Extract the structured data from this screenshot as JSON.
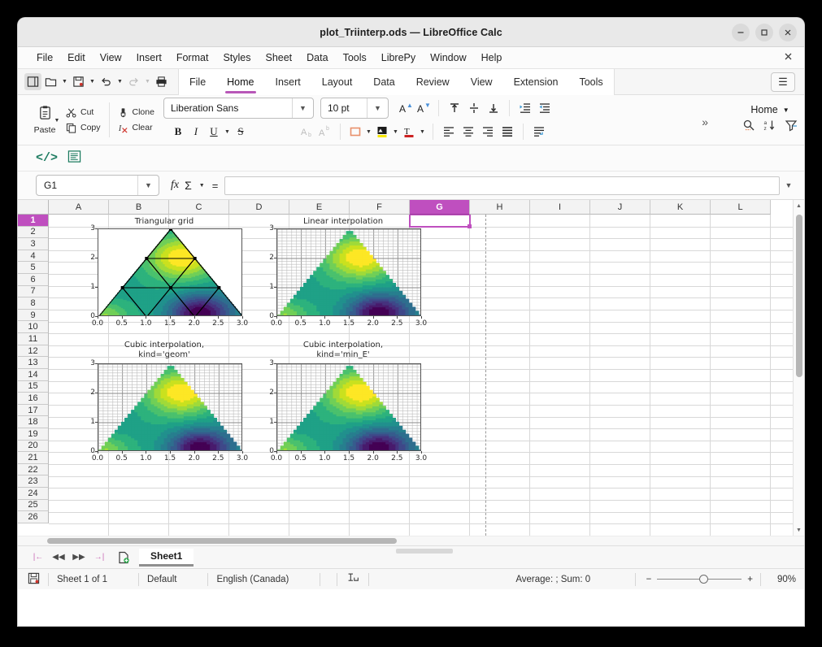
{
  "window": {
    "title": "plot_Triinterp.ods — LibreOffice Calc",
    "minimize": "−",
    "maximize": "□",
    "close": "✕"
  },
  "menubar": {
    "items": [
      "File",
      "Edit",
      "View",
      "Insert",
      "Format",
      "Styles",
      "Sheet",
      "Data",
      "Tools",
      "LibrePy",
      "Window",
      "Help"
    ],
    "close_document": "✕"
  },
  "notebookbar": {
    "tabs": [
      "File",
      "Home",
      "Insert",
      "Layout",
      "Data",
      "Review",
      "View",
      "Extension",
      "Tools"
    ],
    "selected_tab": "Home",
    "menu_button": "☰"
  },
  "ribbon": {
    "paste_label": "Paste",
    "cut_label": "Cut",
    "copy_label": "Copy",
    "clone_label": "Clone",
    "clear_label": "Clear",
    "font_name": "Liberation Sans",
    "font_size": "10 pt",
    "bold": "B",
    "italic": "I",
    "underline": "U",
    "strikethrough": "S",
    "grow_font": "A",
    "shrink_font": "A",
    "overflow": "»",
    "context_label": "Home",
    "accent_color": "#b857b8"
  },
  "formula": {
    "name_box": "G1",
    "fx_label": "fx",
    "sum_label": "Σ",
    "equals_label": "=",
    "input_value": "",
    "input_placeholder": ""
  },
  "grid": {
    "columns": [
      "A",
      "B",
      "C",
      "D",
      "E",
      "F",
      "G",
      "H",
      "I",
      "J",
      "K",
      "L"
    ],
    "selected_column": "G",
    "rows": [
      1,
      2,
      3,
      4,
      5,
      6,
      7,
      8,
      9,
      10,
      11,
      12,
      13,
      14,
      15,
      16,
      17,
      18,
      19,
      20,
      21,
      22,
      23,
      24,
      25,
      26
    ],
    "selected_row": 1,
    "active_cell": "G1"
  },
  "sheet_tabs": {
    "first_label": "|←",
    "prev_label": "◀◀",
    "next_label": "▶▶",
    "last_label": "→|",
    "add_sheet_label": "+",
    "tabs": [
      "Sheet1"
    ],
    "selected": "Sheet1"
  },
  "statusbar": {
    "sheet_info": "Sheet 1 of 1",
    "page_style": "Default",
    "language": "English (Canada)",
    "selection_mode": "",
    "formula_summary": "Average: ; Sum: 0",
    "zoom_out": "−",
    "zoom_in": "+",
    "zoom_level": "90%"
  },
  "chart_data": [
    {
      "type": "heatmap",
      "title": "Triangular grid",
      "xlabel": "",
      "ylabel": "",
      "xlim": [
        0.0,
        3.0
      ],
      "ylim": [
        0,
        3
      ],
      "xticks": [
        "0.0",
        "0.5",
        "1.0",
        "1.5",
        "2.0",
        "2.5",
        "3.0"
      ],
      "yticks": [
        "0",
        "1",
        "2",
        "3"
      ],
      "grid": false,
      "description": "Filled contour plot over a triangular mesh with triangulation edges and node markers drawn on top",
      "mesh_nodes": [
        [
          0,
          0
        ],
        [
          1,
          0
        ],
        [
          2,
          0
        ],
        [
          3,
          0
        ],
        [
          0.5,
          1
        ],
        [
          1.5,
          1
        ],
        [
          2.5,
          1
        ],
        [
          1,
          2
        ],
        [
          2,
          2
        ],
        [
          1.5,
          3
        ]
      ],
      "colormap": "viridis"
    },
    {
      "type": "heatmap",
      "title": "Linear interpolation",
      "xlabel": "",
      "ylabel": "",
      "xlim": [
        0.0,
        3.0
      ],
      "ylim": [
        0,
        3
      ],
      "xticks": [
        "0.0",
        "0.5",
        "1.0",
        "1.5",
        "2.0",
        "2.5",
        "3.0"
      ],
      "yticks": [
        "0",
        "1",
        "2",
        "3"
      ],
      "grid": true,
      "description": "Filled contour of linear triangular interpolation on a fine rectangular grid masked to the triangle",
      "colormap": "viridis"
    },
    {
      "type": "heatmap",
      "title": "Cubic interpolation,\nkind='geom'",
      "xlabel": "",
      "ylabel": "",
      "xlim": [
        0.0,
        3.0
      ],
      "ylim": [
        0,
        3
      ],
      "xticks": [
        "0.0",
        "0.5",
        "1.0",
        "1.5",
        "2.0",
        "2.5",
        "3.0"
      ],
      "yticks": [
        "0",
        "1",
        "2",
        "3"
      ],
      "grid": true,
      "description": "Filled contour of cubic triangular interpolation using geometric kind",
      "colormap": "viridis"
    },
    {
      "type": "heatmap",
      "title": "Cubic interpolation,\nkind='min_E'",
      "xlabel": "",
      "ylabel": "",
      "xlim": [
        0.0,
        3.0
      ],
      "ylim": [
        0,
        3
      ],
      "xticks": [
        "0.0",
        "0.5",
        "1.0",
        "1.5",
        "2.0",
        "2.5",
        "3.0"
      ],
      "yticks": [
        "0",
        "1",
        "2",
        "3"
      ],
      "grid": true,
      "description": "Filled contour of cubic triangular interpolation minimizing bending energy",
      "colormap": "viridis"
    }
  ]
}
